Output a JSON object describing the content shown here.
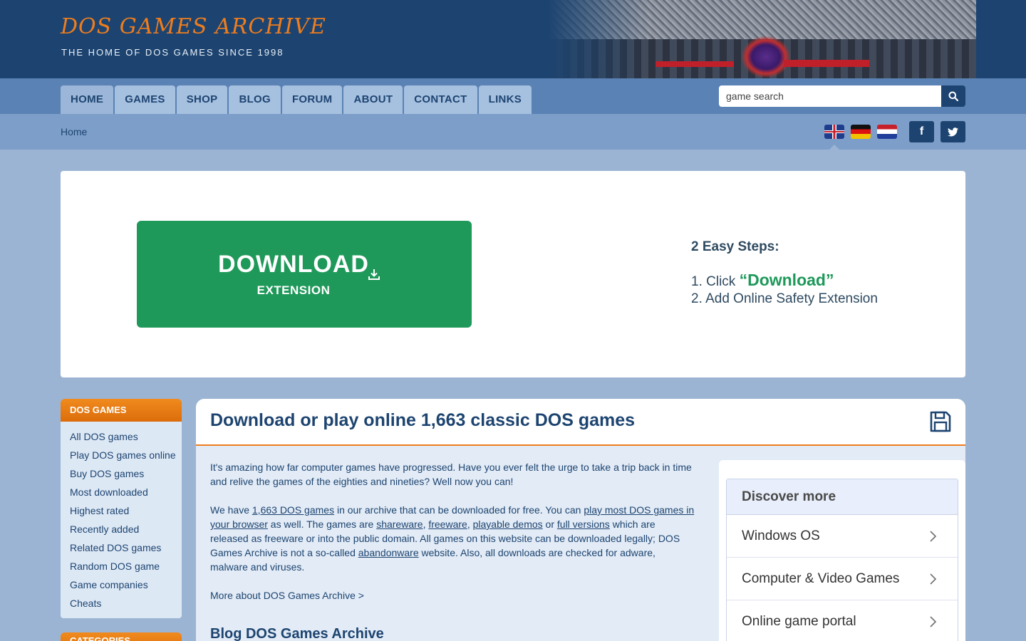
{
  "header": {
    "title": "DOS GAMES ARCHIVE",
    "subtitle": "THE HOME OF DOS GAMES SINCE 1998"
  },
  "nav": {
    "tabs": [
      {
        "label": "HOME",
        "active": true
      },
      {
        "label": "GAMES"
      },
      {
        "label": "SHOP"
      },
      {
        "label": "BLOG"
      },
      {
        "label": "FORUM"
      },
      {
        "label": "ABOUT"
      },
      {
        "label": "CONTACT"
      },
      {
        "label": "LINKS"
      }
    ],
    "search_placeholder": "game search"
  },
  "breadcrumb": "Home",
  "social": {
    "facebook": "f",
    "twitter": "twitter-icon"
  },
  "ad": {
    "button_main": "DOWNLOAD",
    "button_sub": "EXTENSION",
    "steps_title": "2 Easy Steps:",
    "step1_prefix": "1. Click ",
    "step1_highlight": "“Download”",
    "step2": "2. Add Online Safety Extension"
  },
  "sidebar": {
    "heading": "DOS GAMES",
    "links": [
      "All DOS games",
      "Play DOS games online",
      "Buy DOS games",
      "Most downloaded",
      "Highest rated",
      "Recently added",
      "Related DOS games",
      "Random DOS game",
      "Game companies",
      "Cheats"
    ],
    "heading2": "CATEGORIES"
  },
  "main": {
    "title": "Download or play online 1,663 classic DOS games",
    "intro": "It's amazing how far computer games have progressed. Have you ever felt the urge to take a trip back in time and relive the games of the eighties and nineties? Well now you can!",
    "p2": {
      "t1": "We have ",
      "l1": "1,663 DOS games",
      "t2": " in our archive that can be downloaded for free. You can ",
      "l2": "play most DOS games in your browser",
      "t3": " as well.  The games are ",
      "l3": "shareware",
      "t4": ", ",
      "l4": "freeware",
      "t5": ", ",
      "l5": "playable demos",
      "t6": " or ",
      "l6": "full versions",
      "t7": " which are released as freeware or into the public domain. All games on this website can be downloaded legally; DOS Games Archive is not a so-called ",
      "l7": "abandonware",
      "t8": " website. Also, all downloads are checked for adware, malware and viruses."
    },
    "more_link": "More about DOS Games Archive >",
    "blog_title": "Blog DOS Games Archive"
  },
  "discover": {
    "title": "Discover more",
    "items": [
      "Windows OS",
      "Computer & Video Games",
      "Online game portal"
    ]
  },
  "colors": {
    "header_bg": "#1d4470",
    "accent_orange": "#ee7d1e",
    "download_green": "#1f995a",
    "nav_bg": "#5a82b4"
  }
}
